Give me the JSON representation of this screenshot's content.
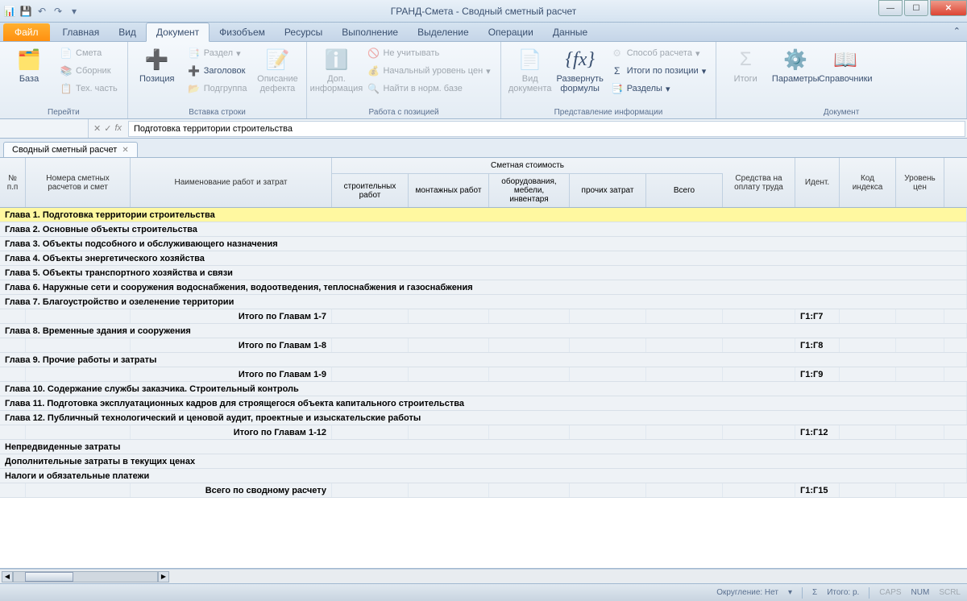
{
  "app_title": "ГРАНД-Смета - Сводный сметный расчет",
  "ribbon_tabs": {
    "file": "Файл",
    "tabs": [
      "Главная",
      "Вид",
      "Документ",
      "Физобъем",
      "Ресурсы",
      "Выполнение",
      "Выделение",
      "Операции",
      "Данные"
    ],
    "active_index": 2
  },
  "ribbon": {
    "groups": {
      "goto": {
        "label": "Перейти",
        "base": "База",
        "smeta": "Смета",
        "sbornik": "Сборник",
        "tech": "Тех. часть"
      },
      "insert": {
        "label": "Вставка строки",
        "position": "Позиция",
        "section": "Раздел",
        "header": "Заголовок",
        "subgroup": "Подгруппа",
        "defect": "Описание дефекта"
      },
      "work": {
        "label": "Работа с позицией",
        "addinfo": "Доп. информация",
        "ignore": "Не учитывать",
        "baselevel": "Начальный уровень цен",
        "find": "Найти в норм. базе"
      },
      "view": {
        "label": "Представление информации",
        "doctype": "Вид документа",
        "expand": "Развернуть формулы",
        "calcmethod": "Способ расчета",
        "totals_per_item": "Итоги по позиции",
        "sections": "Разделы"
      },
      "document": {
        "label": "Документ",
        "totals": "Итоги",
        "params": "Параметры",
        "refs": "Справочники"
      }
    }
  },
  "formula_bar": {
    "value": "Подготовка территории строительства"
  },
  "doc_tab": "Сводный сметный расчет",
  "columns": {
    "num": "№ п.п",
    "refs": "Номера сметных расчетов и смет",
    "name": "Наименование работ и затрат",
    "cost_group": "Сметная стоимость",
    "cost_sub": [
      "строительных работ",
      "монтажных работ",
      "оборудования, мебели, инвентаря",
      "прочих затрат",
      "Всего"
    ],
    "funds": "Средства на оплату труда",
    "ident": "Идент.",
    "index_code": "Код индекса",
    "price_level": "Уровень цен"
  },
  "rows": [
    {
      "type": "chapter",
      "selected": true,
      "name": "Глава 1. Подготовка территории строительства"
    },
    {
      "type": "chapter",
      "name": "Глава 2. Основные объекты строительства"
    },
    {
      "type": "chapter",
      "name": "Глава 3. Объекты подсобного и обслуживающего назначения"
    },
    {
      "type": "chapter",
      "name": "Глава 4. Объекты энергетического хозяйства"
    },
    {
      "type": "chapter",
      "name": "Глава 5. Объекты транспортного хозяйства и связи"
    },
    {
      "type": "chapter",
      "name": "Глава 6. Наружные сети и сооружения водоснабжения, водоотведения, теплоснабжения и газоснабжения"
    },
    {
      "type": "chapter",
      "name": "Глава 7. Благоустройство и озеленение территории"
    },
    {
      "type": "total",
      "name": "Итого по Главам 1-7",
      "ident": "Г1:Г7"
    },
    {
      "type": "chapter",
      "name": "Глава 8. Временные здания и сооружения"
    },
    {
      "type": "total",
      "name": "Итого по Главам 1-8",
      "ident": "Г1:Г8"
    },
    {
      "type": "chapter",
      "name": "Глава 9. Прочие работы и затраты"
    },
    {
      "type": "total",
      "name": "Итого по Главам 1-9",
      "ident": "Г1:Г9"
    },
    {
      "type": "chapter",
      "name": "Глава 10. Содержание службы заказчика. Строительный контроль"
    },
    {
      "type": "chapter",
      "name": "Глава 11. Подготовка эксплуатационных кадров для строящегося объекта капитального строительства"
    },
    {
      "type": "chapter",
      "name": "Глава 12. Публичный технологический и ценовой аудит, проектные и изыскательские работы"
    },
    {
      "type": "total",
      "name": "Итого по Главам 1-12",
      "ident": "Г1:Г12"
    },
    {
      "type": "section",
      "name": "Непредвиденные затраты"
    },
    {
      "type": "section",
      "name": "Дополнительные затраты в текущих ценах"
    },
    {
      "type": "section",
      "name": "Налоги и обязательные платежи"
    },
    {
      "type": "total",
      "name": "Всего по сводному расчету",
      "ident": "Г1:Г15"
    }
  ],
  "statusbar": {
    "rounding": "Округление: Нет",
    "total": "Итого: р.",
    "caps": "CAPS",
    "num": "NUM",
    "scrl": "SCRL"
  }
}
